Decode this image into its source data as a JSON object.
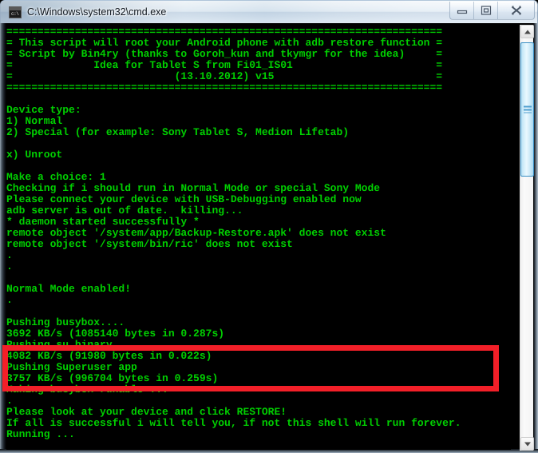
{
  "window": {
    "title": "C:\\Windows\\system32\\cmd.exe",
    "icon": "cmd-console-icon",
    "prompt_glyph": "c:\\",
    "buttons": {
      "minimize": "Minimize",
      "restore": "Restore Down",
      "close": "Close"
    }
  },
  "theme": {
    "console_background": "#000000",
    "console_foreground": "#00d000",
    "highlight_border": "#f21f28",
    "scrollbar_thumb": "#cfeaf8",
    "titlebar_text": "#10171f"
  },
  "scrollbar": {
    "up_arrow": "scroll-up-arrow",
    "down_arrow": "scroll-down-arrow",
    "thumb": "scroll-thumb"
  },
  "console": {
    "lines": [
      "======================================================================",
      "= This script will root your Android phone with adb restore function =",
      "= Script by Bin4ry (thanks to Goroh_kun and tkymgr for the idea)     =",
      "=             Idea for Tablet S from Fi01_IS01                       =",
      "=                          (13.10.2012) v15                          =",
      "======================================================================",
      "",
      "Device type:",
      "1) Normal",
      "2) Special (for example: Sony Tablet S, Medion Lifetab)",
      "",
      "x) Unroot",
      "",
      "Make a choice: 1",
      "Checking if i should run in Normal Mode or special Sony Mode",
      "Please connect your device with USB-Debugging enabled now",
      "adb server is out of date.  killing...",
      "* daemon started successfully *",
      "remote object '/system/app/Backup-Restore.apk' does not exist",
      "remote object '/system/bin/ric' does not exist",
      ".",
      ".",
      "",
      "Normal Mode enabled!",
      ".",
      "",
      "Pushing busybox....",
      "3692 KB/s (1085140 bytes in 0.287s)",
      "Pushing su binary ....",
      "4082 KB/s (91980 bytes in 0.022s)",
      "Pushing Superuser app",
      "3757 KB/s (996704 bytes in 0.259s)",
      "Making busybox runable ...",
      ".",
      "Please look at your device and click RESTORE!",
      "If all is successful i will tell you, if not this shell will run forever.",
      "Running ..."
    ]
  },
  "annotation": {
    "type": "red-highlight-rectangle",
    "highlighted_lines": [
      "Please look at your device and click RESTORE!",
      "If all is successful i will tell you, if not this shell will run forever.",
      "Running ..."
    ]
  }
}
